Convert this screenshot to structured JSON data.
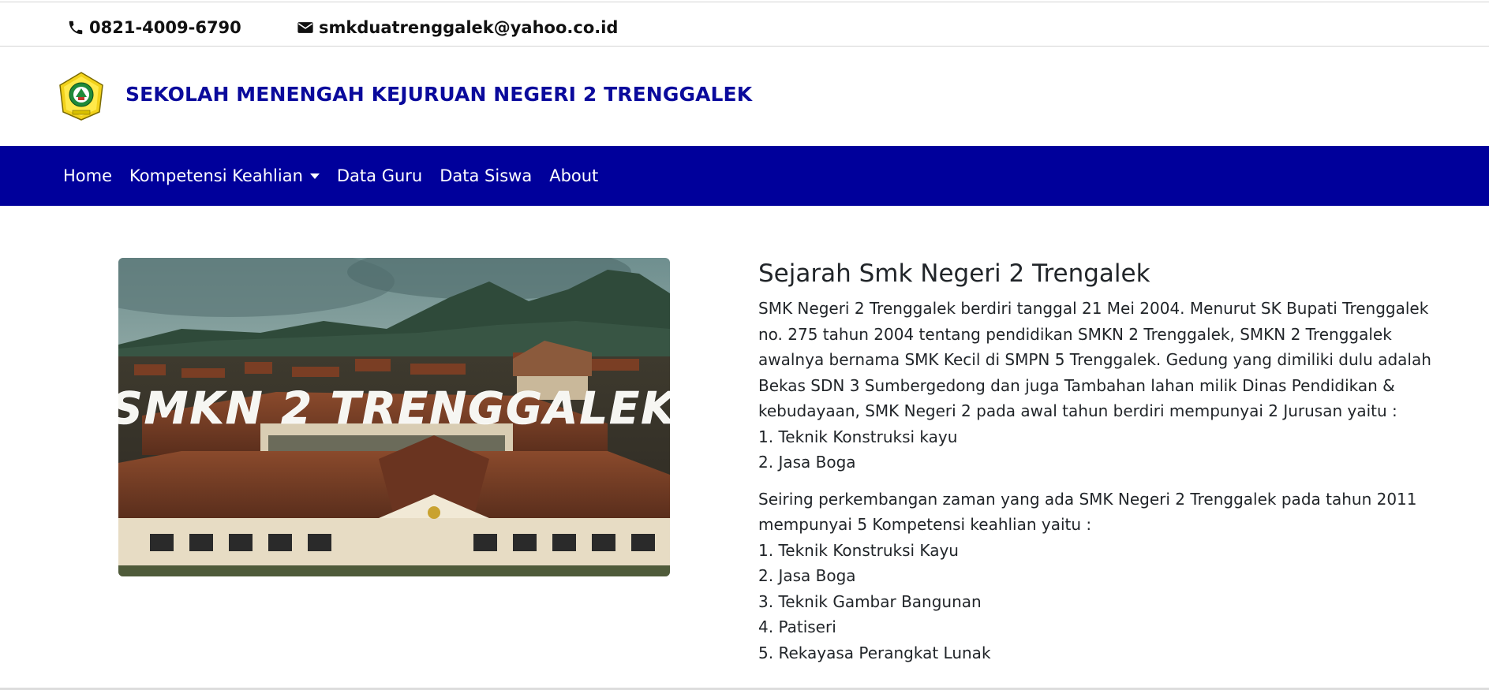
{
  "topbar": {
    "phone": "0821-4009-6790",
    "email": "smkduatrenggalek@yahoo.co.id",
    "phone_icon": "phone-icon",
    "email_icon": "envelope-icon"
  },
  "header": {
    "school_name": "SEKOLAH MENENGAH KEJURUAN NEGERI 2 TRENGGALEK",
    "logo": "school-emblem-logo"
  },
  "nav": {
    "items": [
      {
        "label": "Home"
      },
      {
        "label": "Kompetensi Keahlian",
        "dropdown": true
      },
      {
        "label": "Data Guru"
      },
      {
        "label": "Data Siswa"
      },
      {
        "label": "About"
      }
    ]
  },
  "hero": {
    "overlay_text": "SMKN 2 TRENGGALEK"
  },
  "history": {
    "title": "Sejarah Smk Negeri 2 Trengalek",
    "paragraph1": "SMK Negeri 2 Trenggalek berdiri tanggal 21 Mei 2004. Menurut SK Bupati Trenggalek no. 275 tahun 2004 tentang pendidikan SMKN 2 Trenggalek, SMKN 2 Trenggalek awalnya bernama SMK Kecil di SMPN 5 Trenggalek. Gedung yang dimiliki dulu adalah Bekas SDN 3 Sumbergedong dan juga Tambahan lahan milik Dinas Pendidikan & kebudayaan, SMK Negeri 2 pada awal tahun berdiri mempunyai 2 Jurusan yaitu :",
    "initial_majors": [
      "1. Teknik Konstruksi kayu",
      "2. Jasa Boga"
    ],
    "paragraph2": "Seiring perkembangan zaman yang ada SMK Negeri 2 Trenggalek pada tahun 2011 mempunyai 5 Kompetensi keahlian yaitu :",
    "current_majors": [
      "1. Teknik Konstruksi Kayu",
      "2. Jasa Boga",
      "3. Teknik Gambar Bangunan",
      "4. Patiseri",
      "5. Rekayasa Perangkat Lunak"
    ]
  },
  "colors": {
    "navbar": "#00009b",
    "brand_title": "#0a0a9c",
    "text": "#212529"
  }
}
